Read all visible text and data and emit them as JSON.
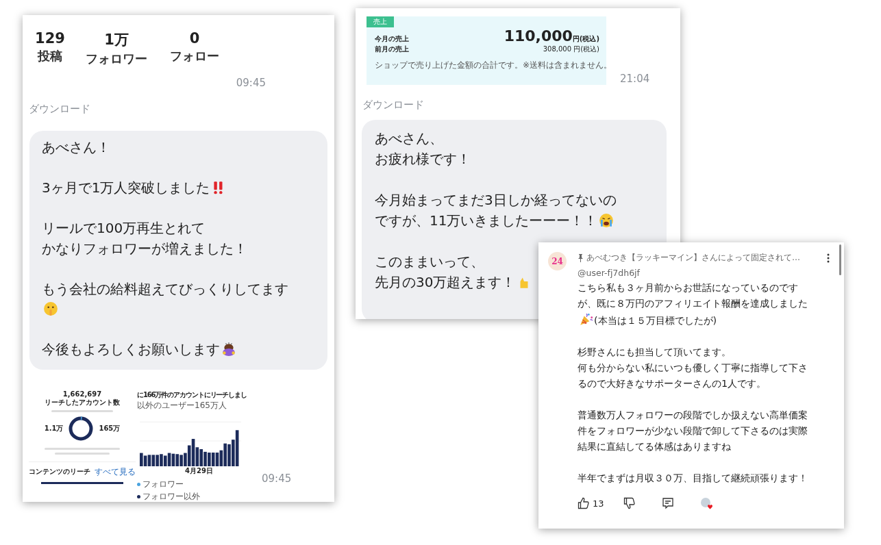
{
  "profile_chat": {
    "stats": [
      {
        "value": "129",
        "label": "投稿"
      },
      {
        "value": "1万",
        "label": "フォロワー"
      },
      {
        "value": "0",
        "label": "フォロー"
      }
    ],
    "time_1": "09:45",
    "download_label": "ダウンロード",
    "message": [
      {
        "lines": [
          "あべさん！"
        ],
        "kind": "plain"
      },
      {
        "lines": [
          "3ヶ月で1万人突破しました"
        ],
        "kind": "exclaim"
      },
      {
        "lines": [
          "リールで100万再生とれて",
          "かなりフォロワーが増えました！"
        ],
        "kind": "plain"
      },
      {
        "lines": [
          "もう会社の給料超えてびっくりしてます"
        ],
        "kind": "hush"
      },
      {
        "lines": [
          "今後もよろしくお願いします"
        ],
        "kind": "bow"
      }
    ],
    "insights_image": {
      "total": "1,662,697",
      "total_label": "リーチしたアカウント数",
      "followers_value": "1.1万",
      "non_followers_value": "165万",
      "content_reach_title": "コンテンツのリーチ",
      "see_all_link": "すべて見る",
      "chart_title": "に166万件のアカウントにリーチしまし",
      "chart_subtitle": "以外のユーザー165万人",
      "x_label": "4月29日",
      "legend": [
        {
          "label": "フォロワー",
          "color": "#4aa3df"
        },
        {
          "label": "フォロワー以外",
          "color": "#1c2b5a"
        }
      ]
    },
    "time_2": "09:45"
  },
  "sales_chat": {
    "sales_widget": {
      "badge": "売上",
      "this_month_label": "今月の売上",
      "this_month_amount": "110,000",
      "this_month_unit": "円(税込)",
      "last_month_label": "前月の売上",
      "last_month_amount": "308,000 円(税込)",
      "note": "ショップで売り上げた金額の合計です。※送料は含まれません。"
    },
    "time": "21:04",
    "download_label": "ダウンロード",
    "message": [
      {
        "lines": [
          "あべさん、",
          "お疲れ様です！"
        ],
        "kind": "plain"
      },
      {
        "lines": [
          "今月始まってまだ3日しか経ってないの",
          "ですが、11万いきましたーーー！！"
        ],
        "kind": "cry"
      },
      {
        "lines": [
          "このままいって、",
          "先月の30万超えます！"
        ],
        "kind": "hand"
      }
    ]
  },
  "comment": {
    "avatar_text": "24",
    "pinned_by": "あべむつき【ラッキーマイン】さんによって固定されて…",
    "author": "@user-fj7dh6jf",
    "paragraphs": [
      {
        "lines": [
          "こちら私も３ヶ月前からお世話になっているのです",
          "が、既に８万円のアフィリエイト報酬を達成しました"
        ],
        "kind": "party",
        "after": "(本当は１５万目標でしたが)"
      },
      {
        "lines": [
          "杉野さんにも担当して頂いてます。",
          "何も分からない私にいつも優しく丁寧に指導して下さ",
          "るので大好きなサポーターさんの1人です。"
        ],
        "kind": "plain"
      },
      {
        "lines": [
          "普通数万人フォロワーの段階でしか扱えない高単価案",
          "件をフォロワーが少ない段階で卸して下さるのは実際",
          "結果に直結してる体感はありますね"
        ],
        "kind": "plain"
      },
      {
        "lines": [
          "半年でまずは月収３０万、目指して継続頑張ります！"
        ],
        "kind": "plain"
      }
    ],
    "like_count": "13"
  }
}
